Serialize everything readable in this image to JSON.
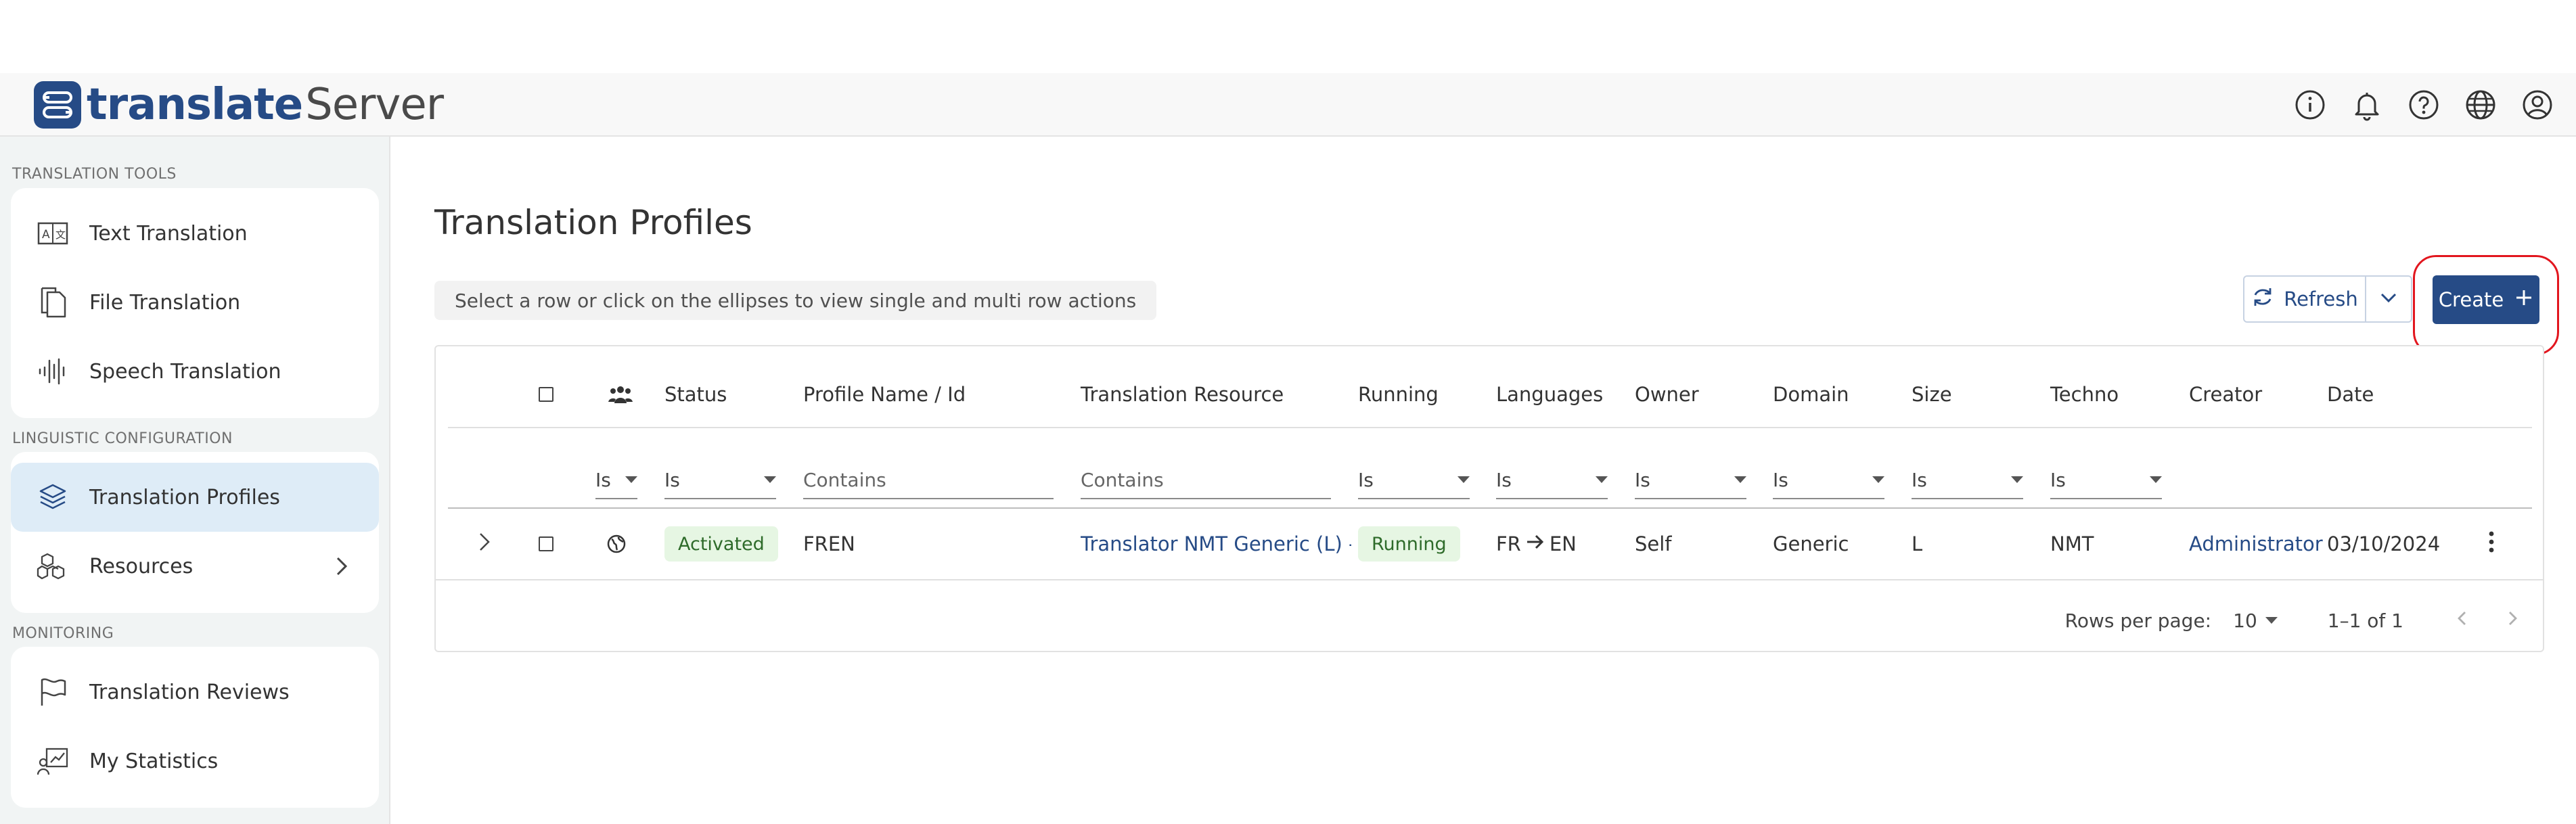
{
  "app": {
    "logo_word1": "translate",
    "logo_word2": "Server"
  },
  "header": {
    "icons": [
      "info-icon",
      "bell-icon",
      "help-icon",
      "globe-icon",
      "account-icon"
    ]
  },
  "sidebar": {
    "sections": [
      {
        "title": "TRANSLATION TOOLS",
        "items": [
          {
            "label": "Text Translation",
            "icon": "text-translation-icon"
          },
          {
            "label": "File Translation",
            "icon": "file-icon"
          },
          {
            "label": "Speech Translation",
            "icon": "waveform-icon"
          }
        ]
      },
      {
        "title": "LINGUISTIC CONFIGURATION",
        "items": [
          {
            "label": "Translation Profiles",
            "icon": "layers-icon",
            "active": true
          },
          {
            "label": "Resources",
            "icon": "cubes-icon"
          }
        ]
      },
      {
        "title": "MONITORING",
        "items": [
          {
            "label": "Translation Reviews",
            "icon": "flag-icon"
          },
          {
            "label": "My Statistics",
            "icon": "statistics-icon"
          }
        ]
      }
    ]
  },
  "main": {
    "title": "Translation Profiles",
    "hint": "Select a row or click on the ellipses to view single and multi row actions",
    "refresh_label": "Refresh",
    "create_label": "Create"
  },
  "table": {
    "columns": [
      "Status",
      "Profile Name / Id",
      "Translation Resource",
      "Running",
      "Languages",
      "Owner",
      "Domain",
      "Size",
      "Techno",
      "Creator",
      "Date"
    ],
    "filters": {
      "owner_group": "Is",
      "status": "Is",
      "profile": "Contains",
      "resource": "Contains",
      "running": "Is",
      "languages": "Is",
      "owner": "Is",
      "domain": "Is",
      "size": "Is",
      "techno": "Is"
    },
    "rows": [
      {
        "status": "Activated",
        "profile": "FREN",
        "resource": "Translator NMT Generic (L) - F",
        "running": "Running",
        "lang_from": "FR",
        "lang_to": "EN",
        "owner": "Self",
        "domain": "Generic",
        "size": "L",
        "techno": "NMT",
        "creator": "Administrator",
        "date": "03/10/2024"
      }
    ],
    "rows_per_page_label": "Rows per page:",
    "rows_per_page": "10",
    "range": "1–1 of 1"
  },
  "colors": {
    "brand": "#264b86",
    "highlight": "#e2161e",
    "active_bg": "#deecf7",
    "badge_bg": "#e6f6e3"
  }
}
